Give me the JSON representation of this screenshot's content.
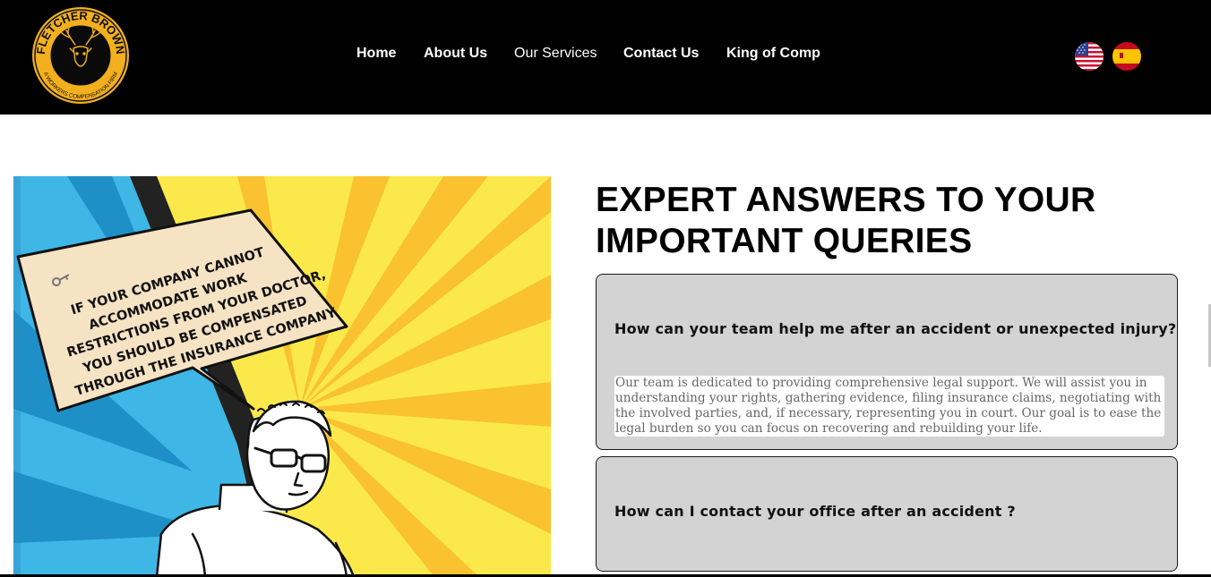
{
  "header": {
    "logo": {
      "brand_name": "FLETCHER BROWN",
      "tagline": "A WORKERS COMPENSATION FIRM",
      "icon": "deer-head-icon"
    },
    "nav": [
      {
        "label": "Home"
      },
      {
        "label": "About Us"
      },
      {
        "label": "Our Services"
      },
      {
        "label": "Contact Us"
      },
      {
        "label": "King of Comp"
      }
    ],
    "languages": [
      {
        "icon": "us-flag-icon"
      },
      {
        "icon": "spain-flag-icon"
      }
    ]
  },
  "illustration": {
    "speech_bubble_lines": [
      "IF YOUR COMPANY CANNOT",
      "ACCOMMODATE WORK",
      "RESTRICTIONS FROM YOUR DOCTOR,",
      "YOU SHOULD BE COMPENSATED",
      "THROUGH THE INSURANCE COMPANY"
    ],
    "key_icon": "key-icon",
    "colors": {
      "sky_blue": "#3eb6e6",
      "yellow": "#fbe94c",
      "ray_orange": "#f9c22e",
      "bubble": "#f6e3c4"
    }
  },
  "main": {
    "headline": "EXPERT ANSWERS TO YOUR IMPORTANT QUERIES",
    "faqs": [
      {
        "question": "How can your team help me after an accident or unexpected injury?",
        "answer": "Our team is dedicated to providing comprehensive legal support. We will assist you in understanding your rights, gathering evidence, filing insurance claims, negotiating with the involved parties, and, if necessary, representing you in court. Our goal is to ease the legal burden so you can focus on recovering and rebuilding your life."
      },
      {
        "question": "How can I contact your office after an accident ?"
      }
    ]
  },
  "colors": {
    "header_bg": "#000000",
    "logo_gold": "#f2b01e",
    "faq_bg": "#d3d3d3",
    "answer_text": "#666666"
  }
}
